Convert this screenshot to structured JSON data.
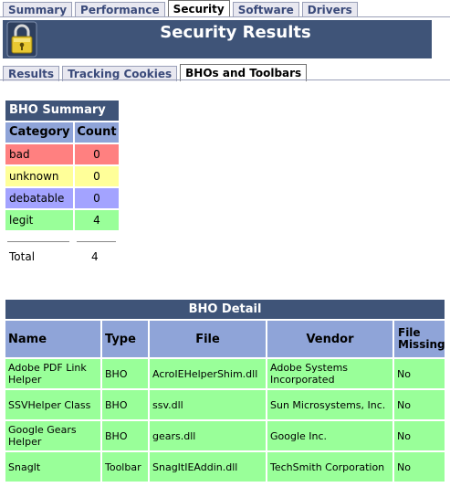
{
  "top_tabs": [
    {
      "label": "Summary"
    },
    {
      "label": "Performance"
    },
    {
      "label": "Security"
    },
    {
      "label": "Software"
    },
    {
      "label": "Drivers"
    }
  ],
  "header": {
    "title": "Security Results",
    "icon": "lock-icon"
  },
  "sub_tabs": [
    {
      "label": "Results"
    },
    {
      "label": "Tracking Cookies"
    },
    {
      "label": "BHOs and Toolbars"
    }
  ],
  "summary": {
    "title": "BHO Summary",
    "col_category": "Category",
    "col_count": "Count",
    "rows": [
      {
        "category": "bad",
        "count": "0"
      },
      {
        "category": "unknown",
        "count": "0"
      },
      {
        "category": "debatable",
        "count": "0"
      },
      {
        "category": "legit",
        "count": "4"
      }
    ],
    "total_label": "Total",
    "total_value": "4"
  },
  "detail": {
    "title": "BHO Detail",
    "columns": [
      "Name",
      "Type",
      "File",
      "Vendor",
      "File Missing"
    ],
    "rows": [
      {
        "name": "Adobe PDF Link Helper",
        "type": "BHO",
        "file": "AcroIEHelperShim.dll",
        "vendor": "Adobe Systems Incorporated",
        "missing": "No"
      },
      {
        "name": "SSVHelper Class",
        "type": "BHO",
        "file": "ssv.dll",
        "vendor": "Sun Microsystems, Inc.",
        "missing": "No"
      },
      {
        "name": "Google Gears Helper",
        "type": "BHO",
        "file": "gears.dll",
        "vendor": "Google Inc.",
        "missing": "No"
      },
      {
        "name": "SnagIt",
        "type": "Toolbar",
        "file": "SnagItIEAddin.dll",
        "vendor": "TechSmith Corporation",
        "missing": "No"
      }
    ]
  },
  "colors": {
    "header_bg": "#3f5478",
    "col_header_bg": "#8fa4d8",
    "bad": "#ff8080",
    "unknown": "#ffff99",
    "debatable": "#a3a3ff",
    "legit": "#99ff99"
  }
}
